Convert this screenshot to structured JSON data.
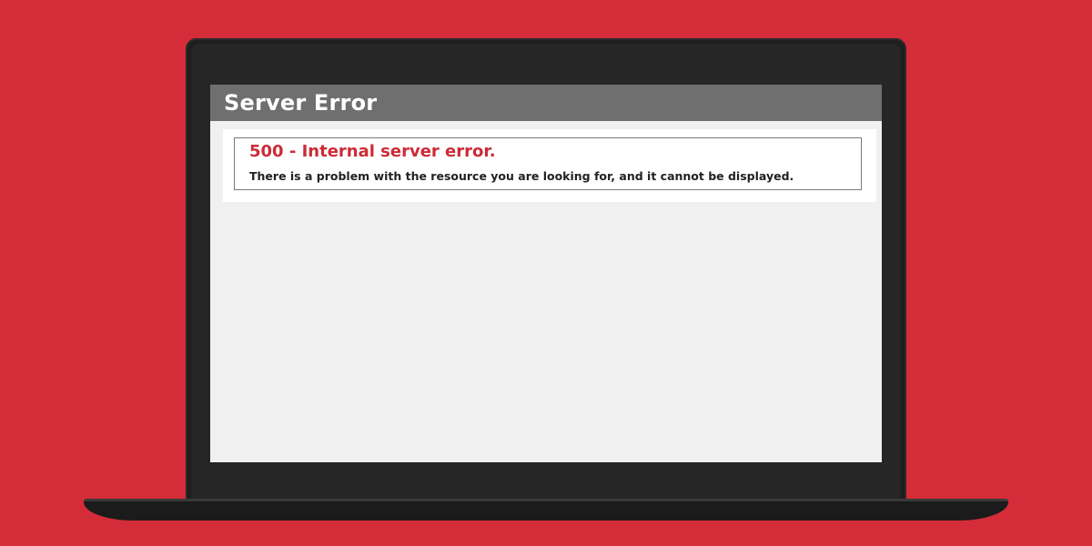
{
  "window": {
    "title": "Server Error"
  },
  "error": {
    "heading": "500 - Internal server error.",
    "message": "There is a problem with the resource you are looking for, and it cannot be displayed."
  },
  "colors": {
    "background": "#d42d39",
    "header": "#6f6f6f",
    "heading_text": "#cc2b36",
    "screen_background": "#f0f0f0"
  }
}
